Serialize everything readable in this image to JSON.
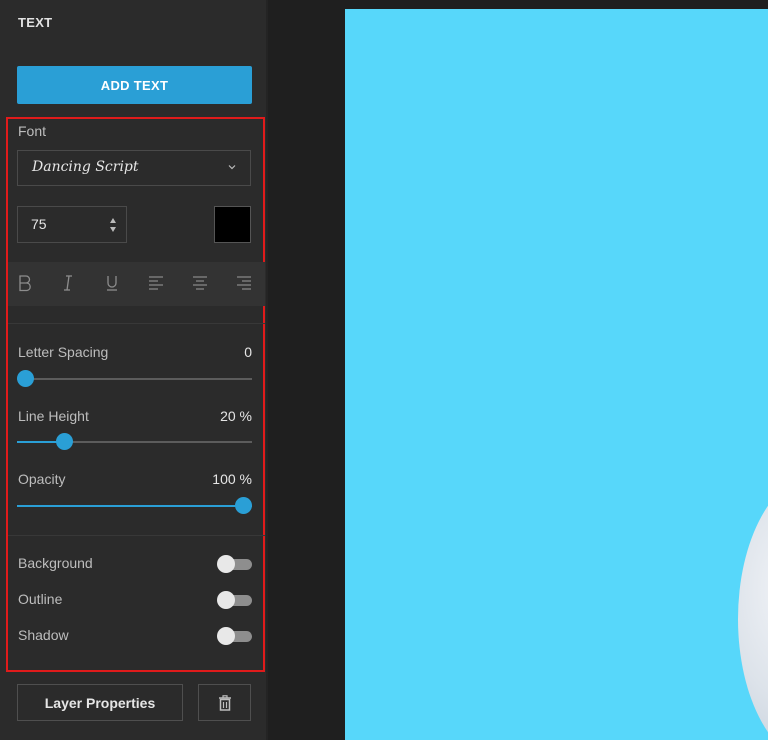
{
  "panel": {
    "title": "TEXT",
    "add_text_label": "ADD TEXT"
  },
  "font": {
    "label": "Font",
    "selected": "Dancing Script",
    "size": "75",
    "color": "#000000"
  },
  "format_icons": [
    "bold-icon",
    "italic-icon",
    "underline-icon",
    "align-left-icon",
    "align-center-icon",
    "align-right-icon"
  ],
  "sliders": {
    "letter_spacing": {
      "label": "Letter Spacing",
      "value_text": "0",
      "fraction": 0.0
    },
    "line_height": {
      "label": "Line Height",
      "value_text": "20 %",
      "fraction": 0.2
    },
    "opacity": {
      "label": "Opacity",
      "value_text": "100 %",
      "fraction": 1.0
    }
  },
  "toggles": {
    "background": {
      "label": "Background",
      "on": false
    },
    "outline": {
      "label": "Outline",
      "on": false
    },
    "shadow": {
      "label": "Shadow",
      "on": false
    }
  },
  "footer": {
    "layer_properties_label": "Layer Properties",
    "trash_icon": "trash-icon"
  },
  "colors": {
    "accent": "#2a9fd6",
    "canvas_background": "#57d7fa",
    "highlight_border": "#e01b1b"
  }
}
